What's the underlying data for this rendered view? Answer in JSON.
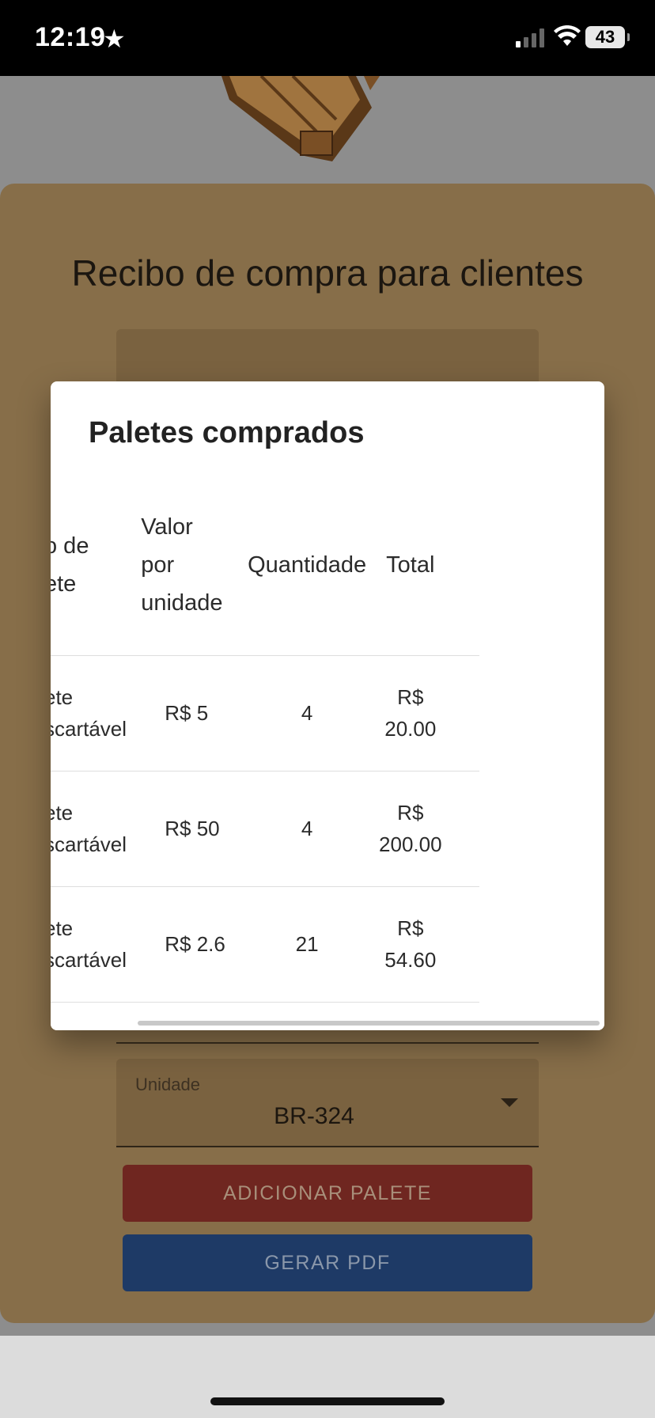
{
  "status_bar": {
    "time": "12:19",
    "battery": "43",
    "icons": [
      "star-icon",
      "signal-icon",
      "wifi-icon",
      "battery-icon"
    ]
  },
  "form": {
    "title": "Recibo de compra para clientes",
    "unit_field": {
      "label": "Unidade",
      "value": "BR-324"
    },
    "add_pallet_button": "ADICIONAR PALETE",
    "generate_pdf_button": "GERAR PDF"
  },
  "modal": {
    "title": "Paletes comprados",
    "columns": {
      "type": "o de\nete",
      "unit_value": "Valor\npor\nunidade",
      "quantity": "Quantidade",
      "total": "Total"
    },
    "rows": [
      {
        "type": "ete\nscartável",
        "unit_value": "R$ 5",
        "quantity": "4",
        "total": "R$\n20.00"
      },
      {
        "type": "ete\nscartável",
        "unit_value": "R$ 50",
        "quantity": "4",
        "total": "R$\n200.00"
      },
      {
        "type": "ete\nscartável",
        "unit_value": "R$ 2.6",
        "quantity": "21",
        "total": "R$\n54.60"
      }
    ]
  },
  "colors": {
    "form_background": "#876e49",
    "add_button": "#6f2620",
    "pdf_button": "#1e3a66",
    "modal_background": "#ffffff"
  }
}
